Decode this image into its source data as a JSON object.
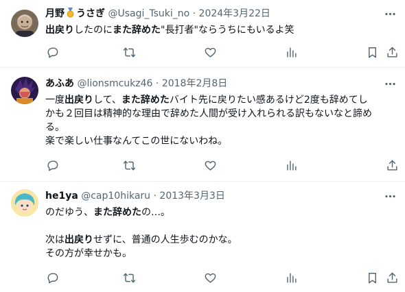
{
  "tweets": [
    {
      "display_name_pre": "月野",
      "display_name_post": "うさぎ",
      "badge_icon": "medal-icon",
      "handle": "@Usagi_Tsuki_no",
      "sep": "·",
      "date": "2024年3月22日",
      "segments": [
        {
          "text": "出戻り",
          "bold": true
        },
        {
          "text": "したのに",
          "bold": false
        },
        {
          "text": "また辞めた",
          "bold": true
        },
        {
          "text": "\"長打者\"ならうちにもいるよ笑",
          "bold": false
        }
      ]
    },
    {
      "display_name": "あふあ",
      "handle": "@lionsmcukz46",
      "sep": "·",
      "date": "2018年2月8日",
      "line1": [
        {
          "text": "一度",
          "bold": false
        },
        {
          "text": "出戻り",
          "bold": true
        },
        {
          "text": "して、",
          "bold": false
        },
        {
          "text": "また辞めた",
          "bold": true
        },
        {
          "text": "バイト先に戻りたい感あるけど2度も辞めてし",
          "bold": false
        }
      ],
      "line2": "かも２回目は精神的な理由で辞めた人間が受け入れられる訳もないなと諦め",
      "line3": "る。",
      "line4": "楽で楽しい仕事なんてこの世にないわね。"
    },
    {
      "display_name": "he1ya",
      "handle": "@cap10hikaru",
      "sep": "·",
      "date": "2013年3月3日",
      "line1": [
        {
          "text": "のだゆう、",
          "bold": false
        },
        {
          "text": "また辞めた",
          "bold": true
        },
        {
          "text": "の…。",
          "bold": false
        }
      ],
      "line2": [
        {
          "text": "次は",
          "bold": false
        },
        {
          "text": "出戻り",
          "bold": true
        },
        {
          "text": "せずに、普通の人生歩むのかな。",
          "bold": false
        }
      ],
      "line3": "その方が幸せかも。"
    }
  ],
  "icons": {
    "more": "more-icon",
    "reply": "reply-icon",
    "retweet": "retweet-icon",
    "like": "like-icon",
    "views": "views-icon",
    "bookmark": "bookmark-icon",
    "share": "share-icon"
  },
  "colors": {
    "text": "#0f1419",
    "meta": "#536471",
    "divider": "#eff3f4"
  }
}
